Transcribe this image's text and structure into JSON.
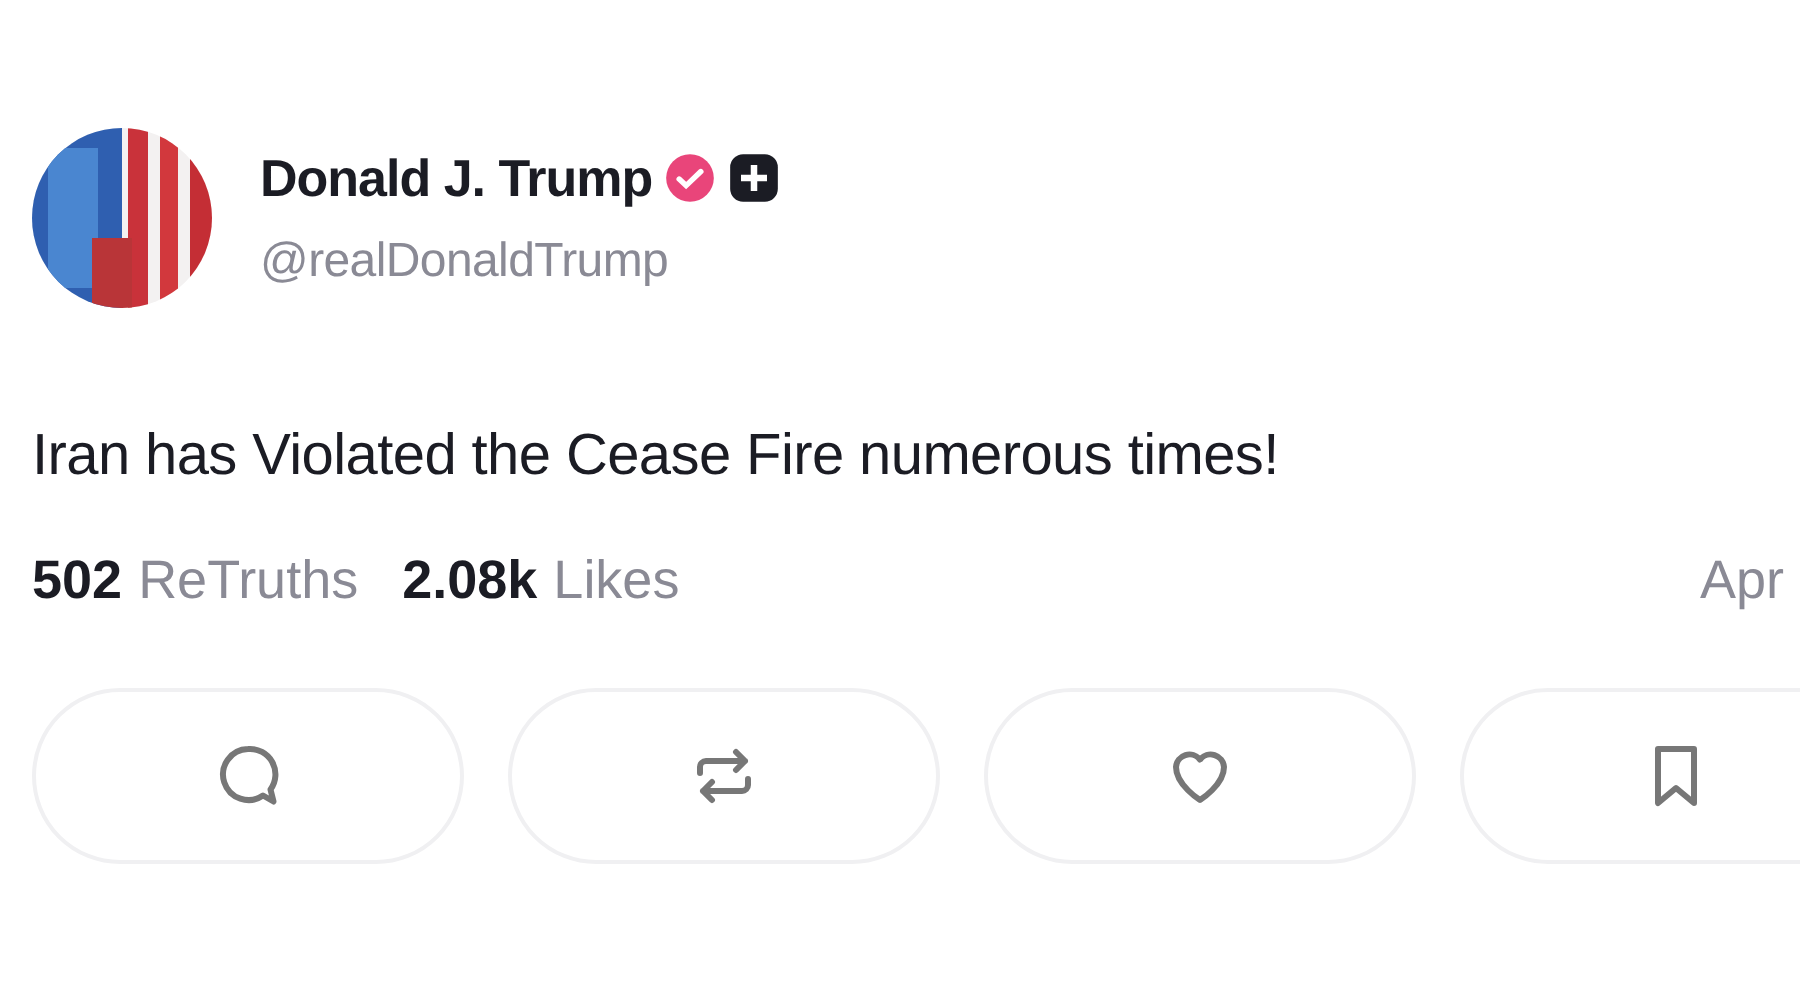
{
  "post": {
    "author": {
      "name": "Donald J. Trump",
      "handle": "@realDonaldTrump",
      "verified": true
    },
    "text": "Iran has Violated the Cease Fire numerous times!",
    "stats": [
      {
        "count": "502",
        "label": "ReTruths"
      },
      {
        "count": "2.08k",
        "label": "Likes"
      }
    ],
    "date": "Apr",
    "actions": [
      {
        "kind": "reply"
      },
      {
        "kind": "retruth"
      },
      {
        "kind": "like"
      },
      {
        "kind": "bookmark"
      }
    ]
  }
}
